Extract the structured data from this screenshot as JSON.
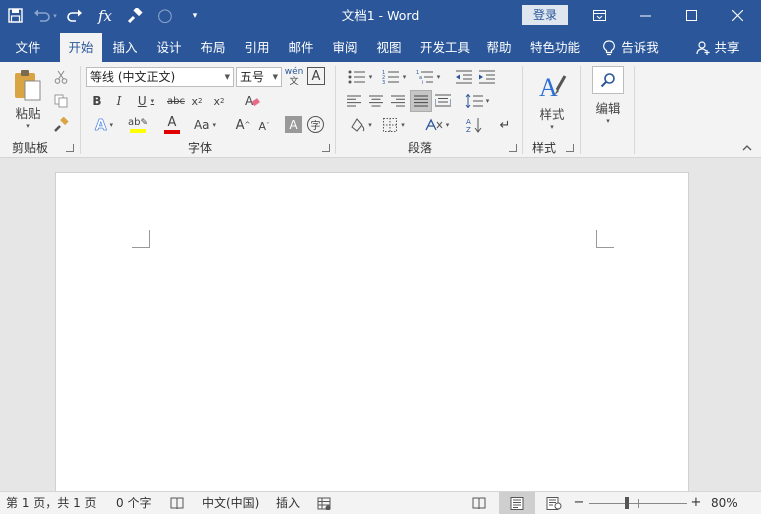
{
  "titlebar": {
    "title": "文档1  -  Word",
    "login_label": "登录",
    "qat": [
      {
        "name": "save-icon",
        "glyph": "💾"
      },
      {
        "name": "undo-icon",
        "glyph": "↶"
      },
      {
        "name": "redo-icon",
        "glyph": "↷"
      },
      {
        "name": "function-icon",
        "glyph": "fx"
      },
      {
        "name": "format-painter-icon",
        "glyph": "🖌"
      },
      {
        "name": "circle-icon",
        "glyph": "○"
      },
      {
        "name": "customize-qat-icon",
        "glyph": "▾"
      }
    ],
    "window_controls": [
      "ribbon-display-options-icon",
      "minimize-icon",
      "maximize-icon",
      "close-icon"
    ]
  },
  "tabs": {
    "items": [
      "文件",
      "开始",
      "插入",
      "设计",
      "布局",
      "引用",
      "邮件",
      "审阅",
      "视图",
      "开发工具",
      "帮助",
      "特色功能"
    ],
    "active": "开始",
    "tell_me": "告诉我",
    "share": "共享"
  },
  "ribbon": {
    "clipboard": {
      "label": "剪贴板",
      "paste": "粘贴"
    },
    "font": {
      "label": "字体",
      "font_name": "等线 (中文正文)",
      "font_size": "五号"
    },
    "paragraph": {
      "label": "段落"
    },
    "styles": {
      "label": "样式",
      "styles_button": "样式"
    },
    "editing": {
      "button": "编辑"
    }
  },
  "statusbar": {
    "page_info": "第 1 页，共 1 页",
    "word_count": "0 个字",
    "language": "中文(中国)",
    "insert_mode": "插入",
    "zoom": "80%",
    "zoom_level": 0.8
  },
  "colors": {
    "brand": "#2b579a",
    "ribbon_bg": "#f3f3f3",
    "highlight": "#ffff00",
    "font_color": "#e00000"
  }
}
